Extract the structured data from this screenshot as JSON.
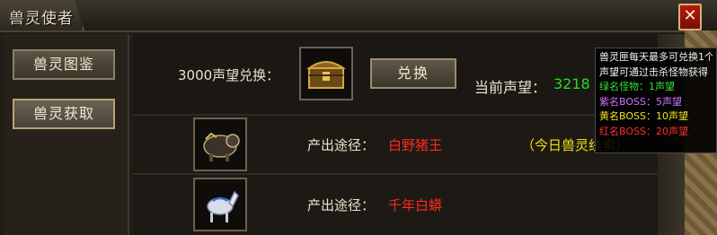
{
  "window": {
    "title": "兽灵使者",
    "close_label": "✕"
  },
  "sidebar": {
    "items": [
      {
        "label": "兽灵图鉴"
      },
      {
        "label": "兽灵获取"
      }
    ]
  },
  "exchange": {
    "cost_label": "3000声望兑换：",
    "button_label": "兑换",
    "current_label": "当前声望：",
    "current_value": "3218"
  },
  "sources": [
    {
      "label": "产出途径：",
      "value": "白野猪王",
      "extra": "（今日兽灵线索）"
    },
    {
      "label": "产出途径：",
      "value": "千年白蟒"
    }
  ],
  "tooltip": {
    "lines": [
      "兽灵匣每天最多可兑换1个",
      "声望可通过击杀怪物获得",
      "绿名怪物：1声望",
      "紫名BOSS：5声望",
      "黄名BOSS：10声望",
      "红名BOSS：20声望"
    ]
  }
}
